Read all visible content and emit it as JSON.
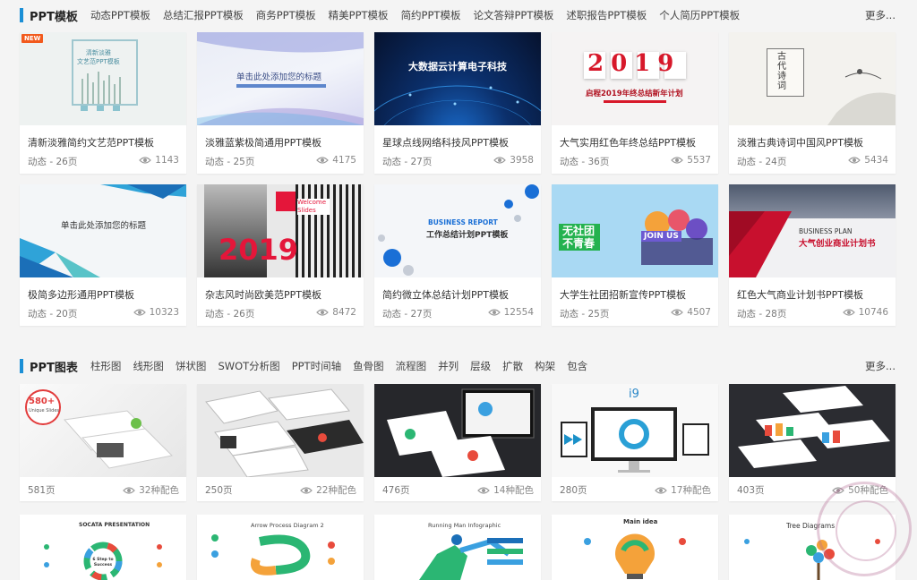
{
  "templates_section": {
    "title": "PPT模板",
    "tabs": [
      "动态PPT模板",
      "总结汇报PPT模板",
      "商务PPT模板",
      "精美PPT模板",
      "简约PPT模板",
      "论文答辩PPT模板",
      "述职报告PPT模板",
      "个人简历PPT模板"
    ],
    "more": "更多...",
    "cards": [
      {
        "name": "清新淡雅简约文艺范PPT模板",
        "meta": "动态 - 26页",
        "views": "1143",
        "badge": "NEW",
        "thumb_text": "清新淡雅\n文艺范PPT模板"
      },
      {
        "name": "淡雅蓝紫极简通用PPT模板",
        "meta": "动态 - 25页",
        "views": "4175",
        "thumb_text": "单击此处添加您的标题"
      },
      {
        "name": "星球点线网络科技风PPT模板",
        "meta": "动态 - 27页",
        "views": "3958",
        "thumb_text": "大数据云计算电子科技"
      },
      {
        "name": "大气实用红色年终总结PPT模板",
        "meta": "动态 - 36页",
        "views": "5537",
        "thumb_text": "2019",
        "thumb_sub": "启程2019年终总结新年计划"
      },
      {
        "name": "淡雅古典诗词中国风PPT模板",
        "meta": "动态 - 24页",
        "views": "5434",
        "thumb_text": "古代诗词"
      },
      {
        "name": "极简多边形通用PPT模板",
        "meta": "动态 - 20页",
        "views": "10323",
        "thumb_text": "单击此处添加您的标题"
      },
      {
        "name": "杂志风时尚欧美范PPT模板",
        "meta": "动态 - 26页",
        "views": "8472",
        "thumb_text": "2019",
        "thumb_sub": "Welcome Slides"
      },
      {
        "name": "简约微立体总结计划PPT模板",
        "meta": "动态 - 27页",
        "views": "12554",
        "thumb_text": "BUSINESS REPORT",
        "thumb_sub": "工作总结计划PPT模板"
      },
      {
        "name": "大学生社团招新宣传PPT模板",
        "meta": "动态 - 25页",
        "views": "4507",
        "thumb_text": "无社团 不青春",
        "thumb_sub": "JOIN US"
      },
      {
        "name": "红色大气商业计划书PPT模板",
        "meta": "动态 - 28页",
        "views": "10746",
        "thumb_text": "BUSINESS PLAN",
        "thumb_sub": "大气创业商业计划书"
      }
    ]
  },
  "charts_section": {
    "title": "PPT图表",
    "tabs": [
      "柱形图",
      "线形图",
      "饼状图",
      "SWOT分析图",
      "PPT时间轴",
      "鱼骨图",
      "流程图",
      "并列",
      "层级",
      "扩散",
      "构架",
      "包含"
    ],
    "more": "更多...",
    "cards": [
      {
        "meta": "581页",
        "views": "32种配色",
        "thumb_text": "580+",
        "thumb_sub": "Unique Slides"
      },
      {
        "meta": "250页",
        "views": "22种配色"
      },
      {
        "meta": "476页",
        "views": "14种配色"
      },
      {
        "meta": "280页",
        "views": "17种配色",
        "thumb_text": "i9"
      },
      {
        "meta": "403页",
        "views": "50种配色"
      }
    ],
    "bottom_cards": [
      {
        "thumb_text": "SOCATA PRESENTATION",
        "thumb_sub": "6 Step to Success"
      },
      {
        "thumb_text": "Arrow Process Diagram 2"
      },
      {
        "thumb_text": "Running Man Infographic"
      },
      {
        "thumb_text": "Main idea"
      },
      {
        "thumb_text": "Tree Diagrams"
      }
    ]
  },
  "colors": {
    "accent": "#1b8fd6",
    "badge": "#f25a1d",
    "red": "#d7182a"
  },
  "icons": {
    "views": "eye-icon",
    "colors": "palette-icon",
    "stamp": "university-seal-watermark"
  }
}
